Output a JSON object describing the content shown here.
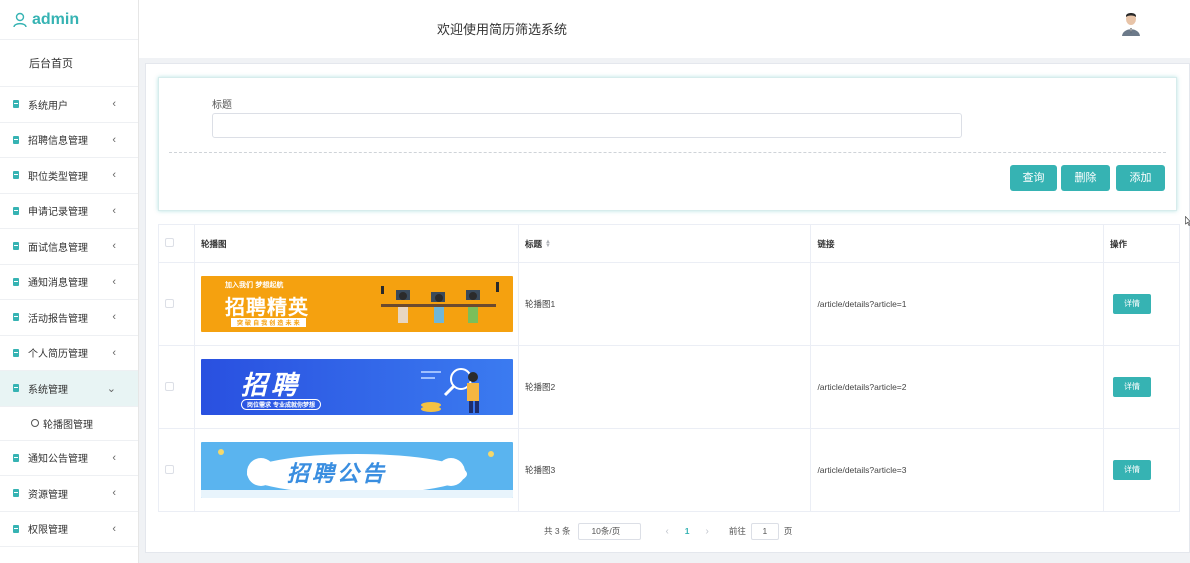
{
  "brand": {
    "name": "admin",
    "icon": "user-icon"
  },
  "header": {
    "title": "欢迎使用简历筛选系统",
    "avatar_icon": "avatar-icon"
  },
  "sidebar": {
    "home": "后台首页",
    "items": [
      {
        "label": "系统用户",
        "chevron": "‹"
      },
      {
        "label": "招聘信息管理",
        "chevron": "‹"
      },
      {
        "label": "职位类型管理",
        "chevron": "‹"
      },
      {
        "label": "申请记录管理",
        "chevron": "‹"
      },
      {
        "label": "面试信息管理",
        "chevron": "‹"
      },
      {
        "label": "通知消息管理",
        "chevron": "‹"
      },
      {
        "label": "活动报告管理",
        "chevron": "‹"
      },
      {
        "label": "个人简历管理",
        "chevron": "‹"
      },
      {
        "label": "系统管理",
        "chevron": "⌄",
        "active": true
      },
      {
        "label": "通知公告管理",
        "chevron": "‹"
      },
      {
        "label": "资源管理",
        "chevron": "‹"
      },
      {
        "label": "权限管理",
        "chevron": "‹"
      }
    ],
    "submenu": {
      "label": "轮播图管理"
    }
  },
  "search": {
    "title_label": "标题",
    "title_value": "",
    "query_btn": "查询",
    "delete_btn": "删除",
    "add_btn": "添加"
  },
  "table": {
    "columns": [
      "轮播图",
      "标题",
      "链接",
      "操作"
    ],
    "rows": [
      {
        "title": "轮播图1",
        "link": "/article/details?article=1",
        "action": "详情",
        "banner": {
          "headline": "招聘精英",
          "tagline": "加入我们 梦想起航",
          "sub": "突 破 自 我 创 造 未 来",
          "bg": "#f5a10f"
        }
      },
      {
        "title": "轮播图2",
        "link": "/article/details?article=2",
        "action": "详情",
        "banner": {
          "headline": "招聘",
          "sub": "岗位需求 专业成就你梦想",
          "bg": "#2f5ee0"
        }
      },
      {
        "title": "轮播图3",
        "link": "/article/details?article=3",
        "action": "详情",
        "banner": {
          "headline": "招聘公告",
          "bg": "#5ab4ef"
        }
      }
    ]
  },
  "pagination": {
    "total": "共 3 条",
    "page_size": "10条/页",
    "prev": "‹",
    "current": "1",
    "next": "›",
    "goto_label": "前往",
    "goto_value": "1",
    "page_suffix": "页"
  },
  "colors": {
    "accent": "#36b3b3"
  }
}
